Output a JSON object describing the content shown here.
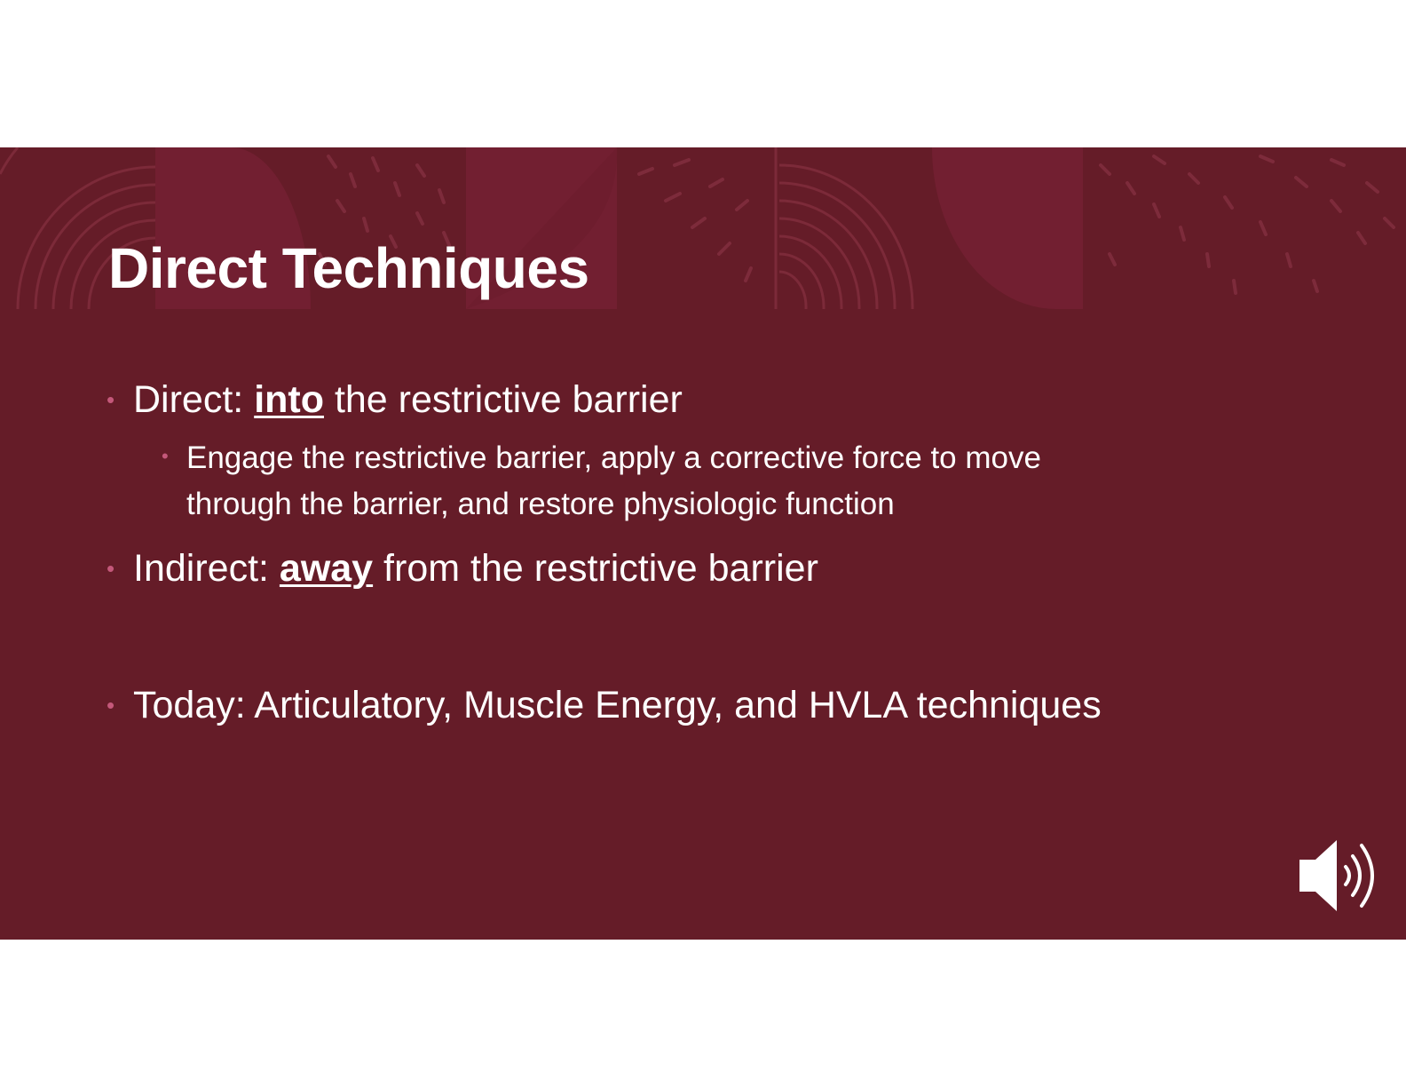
{
  "slide": {
    "title": "Direct Techniques",
    "bullets": [
      {
        "prefix": "Direct: ",
        "emphasis": "into",
        "suffix": " the restrictive barrier"
      },
      {
        "text": "Engage the restrictive barrier, apply a corrective force to move through the barrier, and restore physiologic function"
      },
      {
        "prefix": "Indirect: ",
        "emphasis": "away",
        "suffix": " from the restrictive barrier"
      },
      {
        "text": "Today: Articulatory, Muscle Energy, and HVLA techniques"
      }
    ],
    "bullet_glyph": "•",
    "audio_icon": "speaker-icon"
  },
  "colors": {
    "background": "#651c28",
    "accent": "#c4587a",
    "text": "#ffffff"
  }
}
